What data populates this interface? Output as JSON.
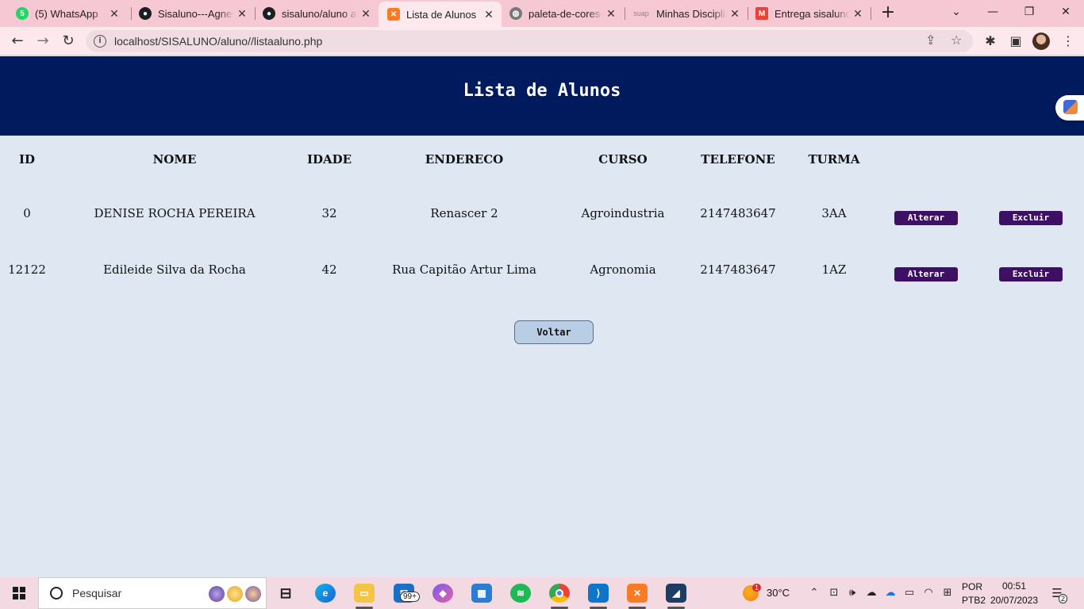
{
  "browser": {
    "tabs": [
      {
        "title": "(5) WhatsApp",
        "icon": "whatsapp-icon",
        "active": false
      },
      {
        "title": "Sisaluno---Agnes",
        "icon": "github-icon",
        "active": false
      },
      {
        "title": "sisaluno/aluno at",
        "icon": "github-icon",
        "active": false
      },
      {
        "title": "Lista de Alunos",
        "icon": "xampp-icon",
        "active": true
      },
      {
        "title": "paleta-de-cores-",
        "icon": "globe-icon",
        "active": false
      },
      {
        "title": "Minhas Disciplina",
        "icon": "suap-icon",
        "active": false
      },
      {
        "title": "Entrega sisaluno",
        "icon": "gmail-icon",
        "active": false
      }
    ],
    "suap_favicon_text": "suap",
    "url": "localhost/SISALUNO/aluno//listaaluno.php"
  },
  "page": {
    "title": "Lista de Alunos",
    "columns": [
      "ID",
      "NOME",
      "IDADE",
      "ENDERECO",
      "CURSO",
      "TELEFONE",
      "TURMA"
    ],
    "rows": [
      {
        "id": "0",
        "nome": "DENISE ROCHA PEREIRA",
        "idade": "32",
        "endereco": "Renascer 2",
        "curso": "Agroindustria",
        "telefone": "2147483647",
        "turma": "3AA"
      },
      {
        "id": "12122",
        "nome": "Edileide Silva da Rocha",
        "idade": "42",
        "endereco": "Rua Capitão Artur Lima",
        "curso": "Agronomia",
        "telefone": "2147483647",
        "turma": "1AZ"
      }
    ],
    "alterar_label": "Alterar",
    "excluir_label": "Excluir",
    "voltar_label": "Voltar"
  },
  "taskbar": {
    "search_placeholder": "Pesquisar",
    "mail_badge": "99+",
    "weather_badge": "1",
    "temperature": "30°C",
    "language_line1": "POR",
    "language_line2": "PTB2",
    "time": "00:51",
    "date": "20/07/2023",
    "notification_count": "2"
  },
  "colors": {
    "header_bg": "#001a5e",
    "page_bg": "#dfe7f3",
    "action_button_bg": "#3d1066",
    "voltar_bg": "#b9cde5",
    "tabstrip_bg": "#f6c8d4"
  }
}
